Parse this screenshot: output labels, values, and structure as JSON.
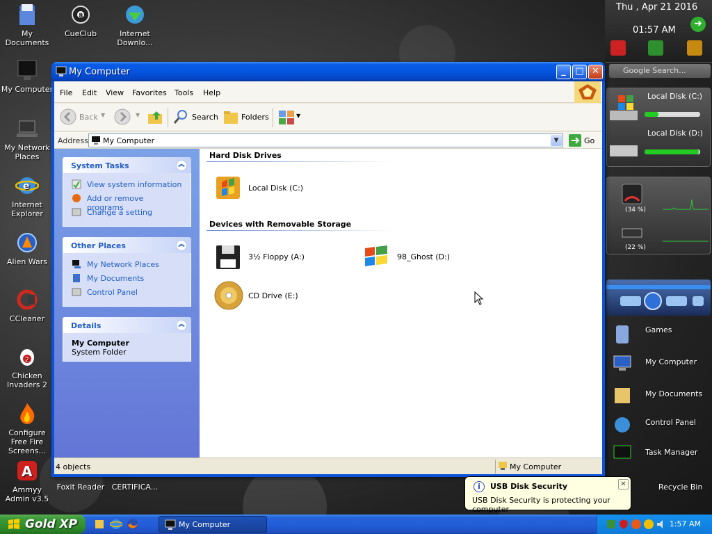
{
  "desktop_icons": [
    {
      "label": "My Documents"
    },
    {
      "label": "CueClub"
    },
    {
      "label": "Internet Downlo..."
    },
    {
      "label": "My Computer"
    },
    {
      "label": "My Network Places"
    },
    {
      "label": "Internet Explorer"
    },
    {
      "label": "Alien Wars"
    },
    {
      "label": "CCleaner"
    },
    {
      "label": "Chicken Invaders 2"
    },
    {
      "label": "Configure Free Fire Screens..."
    },
    {
      "label": "Ammyy Admin v3.5"
    },
    {
      "label": "Foxit Reader"
    },
    {
      "label": "CERTIFICA..."
    }
  ],
  "sidebar": {
    "date": "Thu , Apr 21 2016",
    "time": "01:57 AM",
    "search_placeholder": "Google Search...",
    "drives": [
      {
        "label": "Local Disk (C:)",
        "used": 0.25
      },
      {
        "label": "Local Disk (D:)",
        "used": 0.98
      }
    ],
    "cpu_percent": "(34 %)",
    "ram_percent": "(22 %)",
    "launchers": [
      "Games",
      "My Computer",
      "My Documents",
      "Control Panel",
      "Task Manager",
      "Recycle Bin"
    ]
  },
  "window": {
    "title": "My Computer",
    "menu": [
      "File",
      "Edit",
      "View",
      "Favorites",
      "Tools",
      "Help"
    ],
    "toolbar": {
      "back": "Back",
      "search": "Search",
      "folders": "Folders"
    },
    "address_label": "Address",
    "address_value": "My Computer",
    "go_label": "Go",
    "system_tasks": {
      "title": "System Tasks",
      "items": [
        "View system information",
        "Add or remove programs",
        "Change a setting"
      ]
    },
    "other_places": {
      "title": "Other Places",
      "items": [
        "My Network Places",
        "My Documents",
        "Control Panel"
      ]
    },
    "details": {
      "title": "Details",
      "name": "My Computer",
      "type": "System Folder"
    },
    "groups": {
      "hard_disks": "Hard Disk Drives",
      "removable": "Devices with Removable Storage"
    },
    "drives": {
      "c": "Local Disk (C:)",
      "a": "3½ Floppy (A:)",
      "d": "98_Ghost (D:)",
      "e": "CD Drive (E:)"
    },
    "status_left": "4 objects",
    "status_right": "My Computer"
  },
  "taskbar": {
    "start_label": "Gold XP",
    "task_label": "My Computer",
    "clock": "1:57 AM"
  },
  "balloon": {
    "title": "USB Disk Security",
    "body": "USB Disk Security is protecting your computer"
  },
  "colors": {
    "xp_blue": "#0a53d8",
    "task_link": "#215dc6",
    "start_green": "#3c9b38",
    "bar_green": "#22cc22"
  }
}
